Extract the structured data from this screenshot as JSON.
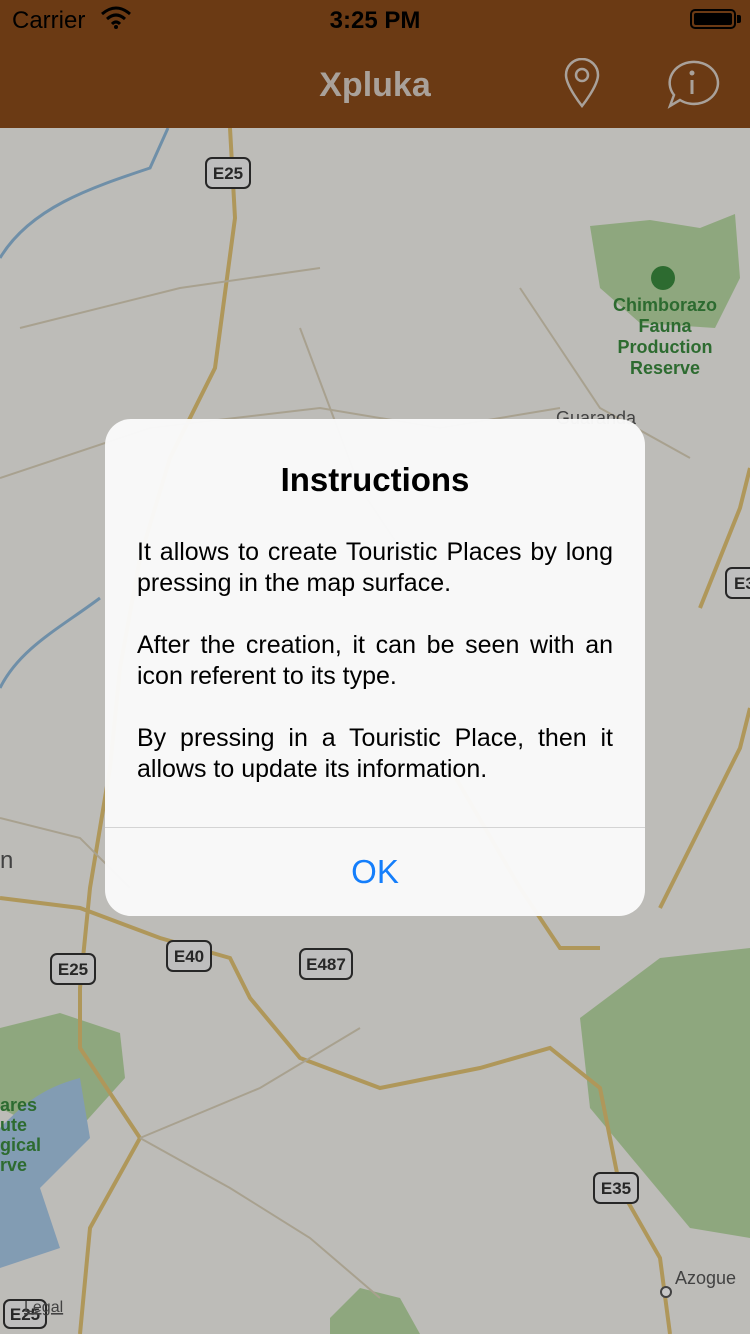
{
  "status_bar": {
    "carrier": "Carrier",
    "time": "3:25 PM"
  },
  "nav": {
    "title": "Xpluka",
    "icons": [
      "location-pin-icon",
      "info-bubble-icon"
    ]
  },
  "map": {
    "road_shields": [
      "E25",
      "E40",
      "E487",
      "E35",
      "E25",
      "E3",
      "E25"
    ],
    "labels": [
      "Chimborazo",
      "Fauna",
      "Production",
      "Reserve",
      "Guaranda",
      "Azogue",
      "n",
      "ares",
      "ute",
      "gical",
      "rve"
    ],
    "legal": "Legal"
  },
  "alert": {
    "title": "Instructions",
    "paragraphs": [
      "It allows to create Touristic Places by long pressing in the map surface.",
      "After the creation, it can be seen with an icon referent to its type.",
      "By pressing in a Touristic Place, then it allows to update its information."
    ],
    "ok_label": "OK"
  },
  "colors": {
    "nav_bg": "#6b3a14",
    "accent": "#147efb",
    "park_green": "#2e8b3a"
  }
}
